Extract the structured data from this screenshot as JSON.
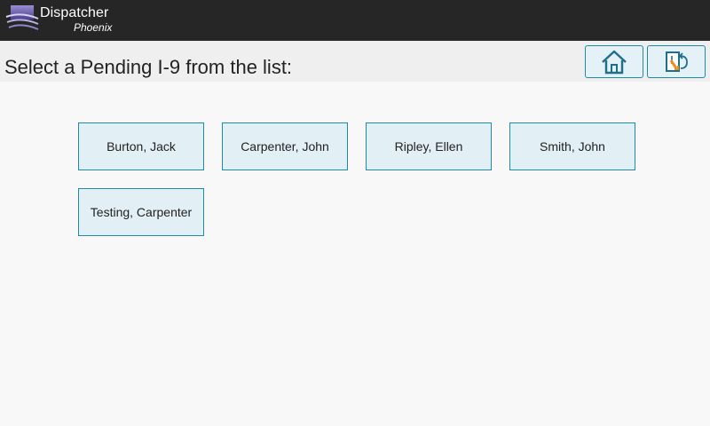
{
  "header": {
    "app_name": "Dispatcher",
    "app_subtitle": "Phoenix"
  },
  "titlebar": {
    "title": "Select a Pending I-9 from the list:"
  },
  "nav": {
    "home_icon": "home-icon",
    "back_icon": "exit-back-icon"
  },
  "colors": {
    "header_bg": "#262626",
    "accent": "#1d8aa8",
    "tile_bg": "#e2eff4"
  },
  "pending_list": [
    {
      "label": "Burton, Jack"
    },
    {
      "label": "Carpenter, John"
    },
    {
      "label": "Ripley, Ellen"
    },
    {
      "label": "Smith, John"
    },
    {
      "label": "Testing, Carpenter"
    }
  ]
}
